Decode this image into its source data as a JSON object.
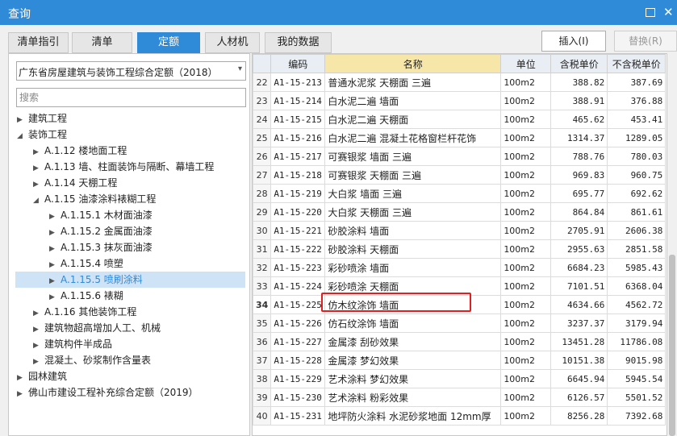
{
  "window": {
    "title": "查询"
  },
  "tabs": [
    {
      "label": "清单指引",
      "active": false
    },
    {
      "label": "清单",
      "active": false
    },
    {
      "label": "定额",
      "active": true
    },
    {
      "label": "人材机",
      "active": false
    },
    {
      "label": "我的数据",
      "active": false
    }
  ],
  "actions": {
    "insert_label": "插入(I)",
    "replace_label": "替换(R)"
  },
  "library": {
    "selected": "广东省房屋建筑与装饰工程综合定额（2018）"
  },
  "search": {
    "placeholder": "搜索"
  },
  "tree": [
    {
      "label": "建筑工程"
    },
    {
      "label": "装饰工程"
    },
    {
      "label": "A.1.12 楼地面工程"
    },
    {
      "label": "A.1.13 墙、柱面装饰与隔断、幕墙工程"
    },
    {
      "label": "A.1.14 天棚工程"
    },
    {
      "label": "A.1.15 油漆涂料裱糊工程"
    },
    {
      "label": "A.1.15.1 木材面油漆"
    },
    {
      "label": "A.1.15.2 金属面油漆"
    },
    {
      "label": "A.1.15.3 抹灰面油漆"
    },
    {
      "label": "A.1.15.4 喷塑"
    },
    {
      "label": "A.1.15.5 喷刷涂料"
    },
    {
      "label": "A.1.15.6 裱糊"
    },
    {
      "label": "A.1.16 其他装饰工程"
    },
    {
      "label": "建筑物超高增加人工、机械"
    },
    {
      "label": "建筑构件半成品"
    },
    {
      "label": "混凝土、砂浆制作含量表"
    },
    {
      "label": "园林建筑"
    },
    {
      "label": "佛山市建设工程补充综合定额（2019）"
    }
  ],
  "table": {
    "headers": [
      "",
      "编码",
      "名称",
      "单位",
      "含税单价",
      "不含税单价"
    ],
    "rows": [
      [
        "22",
        "A1-15-213",
        "普通水泥浆 天棚面 三遍",
        "100m2",
        "388.82",
        "387.69"
      ],
      [
        "23",
        "A1-15-214",
        "白水泥二遍 墙面",
        "100m2",
        "388.91",
        "376.88"
      ],
      [
        "24",
        "A1-15-215",
        "白水泥二遍 天棚面",
        "100m2",
        "465.62",
        "453.41"
      ],
      [
        "25",
        "A1-15-216",
        "白水泥二遍 混凝土花格窗栏杆花饰",
        "100m2",
        "1314.37",
        "1289.05"
      ],
      [
        "26",
        "A1-15-217",
        "可赛银浆 墙面 三遍",
        "100m2",
        "788.76",
        "780.03"
      ],
      [
        "27",
        "A1-15-218",
        "可赛银浆 天棚面 三遍",
        "100m2",
        "969.83",
        "960.75"
      ],
      [
        "28",
        "A1-15-219",
        "大白浆 墙面 三遍",
        "100m2",
        "695.77",
        "692.62"
      ],
      [
        "29",
        "A1-15-220",
        "大白浆 天棚面 三遍",
        "100m2",
        "864.84",
        "861.61"
      ],
      [
        "30",
        "A1-15-221",
        "砂胶涂料 墙面",
        "100m2",
        "2705.91",
        "2606.38"
      ],
      [
        "31",
        "A1-15-222",
        "砂胶涂料 天棚面",
        "100m2",
        "2955.63",
        "2851.58"
      ],
      [
        "32",
        "A1-15-223",
        "彩砂喷涂 墙面",
        "100m2",
        "6684.23",
        "5985.43"
      ],
      [
        "33",
        "A1-15-224",
        "彩砂喷涂 天棚面",
        "100m2",
        "7101.51",
        "6368.04"
      ],
      [
        "34",
        "A1-15-225",
        "仿木纹涂饰 墙面",
        "100m2",
        "4634.66",
        "4562.72"
      ],
      [
        "35",
        "A1-15-226",
        "仿石纹涂饰 墙面",
        "100m2",
        "3237.37",
        "3179.94"
      ],
      [
        "36",
        "A1-15-227",
        "金属漆 刮砂效果",
        "100m2",
        "13451.28",
        "11786.08"
      ],
      [
        "37",
        "A1-15-228",
        "金属漆 梦幻效果",
        "100m2",
        "10151.38",
        "9015.98"
      ],
      [
        "38",
        "A1-15-229",
        "艺术涂料 梦幻效果",
        "100m2",
        "6645.94",
        "5945.54"
      ],
      [
        "39",
        "A1-15-230",
        "艺术涂料 粉彩效果",
        "100m2",
        "6126.57",
        "5501.52"
      ],
      [
        "40",
        "A1-15-231",
        "地坪防火涂料 水泥砂浆地面 12mm厚",
        "100m2",
        "8256.28",
        "7392.68"
      ]
    ]
  },
  "colors": {
    "accent": "#2f8ad8",
    "highlight": "#e02020",
    "name_header": "#f6e7a8"
  }
}
